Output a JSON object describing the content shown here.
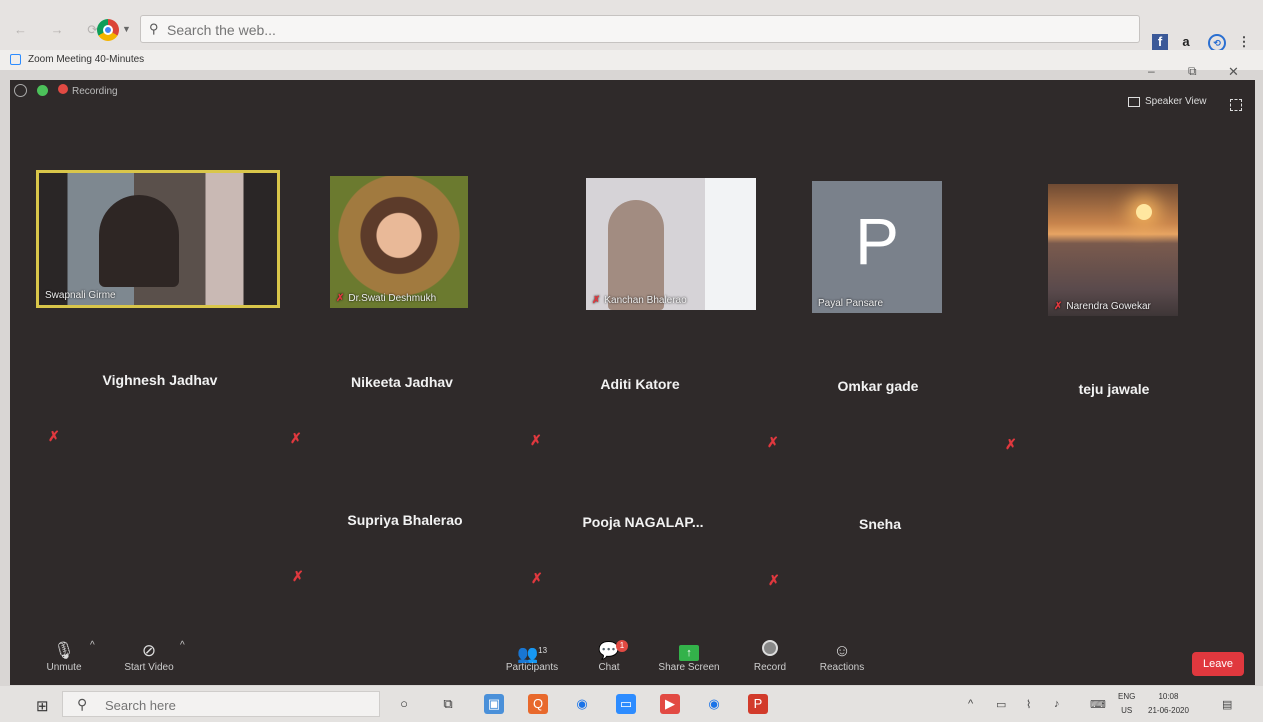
{
  "browser": {
    "search_placeholder": "Search the web...",
    "extensions": [
      "facebook-icon",
      "amazon-icon",
      "sync-icon",
      "menu-icon"
    ]
  },
  "window": {
    "title": "Zoom Meeting 40-Minutes",
    "minimize": "–",
    "maximize": "⧉",
    "close": "✕"
  },
  "meeting": {
    "status": "Recording",
    "view_label": "Speaker View"
  },
  "video_tiles": [
    {
      "name": "Swapnali Girme",
      "muted": false
    },
    {
      "name": "Dr.Swati Deshmukh",
      "muted": true
    },
    {
      "name": "Kanchan Bhalerao",
      "muted": true
    },
    {
      "name": "Payal Pansare",
      "muted": false,
      "initial": "P"
    },
    {
      "name": "Narendra Gowekar",
      "muted": true
    }
  ],
  "name_only_participants": [
    "Vighnesh Jadhav",
    "Nikeeta Jadhav",
    "Aditi Katore",
    "Omkar gade",
    "teju jawale",
    "Supriya Bhalerao",
    "Pooja  NAGALAP...",
    "Sneha"
  ],
  "toolbar": {
    "unmute": "Unmute",
    "start_video": "Start Video",
    "participants": "Participants",
    "participants_count": "13",
    "chat": "Chat",
    "chat_badge": "1",
    "share_screen": "Share Screen",
    "record": "Record",
    "reactions": "Reactions",
    "leave": "Leave"
  },
  "taskbar": {
    "search_placeholder": "Search here",
    "lang_top": "ENG",
    "lang_bottom": "US",
    "time": "10:08",
    "date": "21-06-2020"
  },
  "colors": {
    "meeting_bg": "#2f2a2a",
    "active_speaker_border": "#d9c64a",
    "mute_red": "#e0383e",
    "leave_red": "#e0383e",
    "share_green": "#33b24a"
  }
}
